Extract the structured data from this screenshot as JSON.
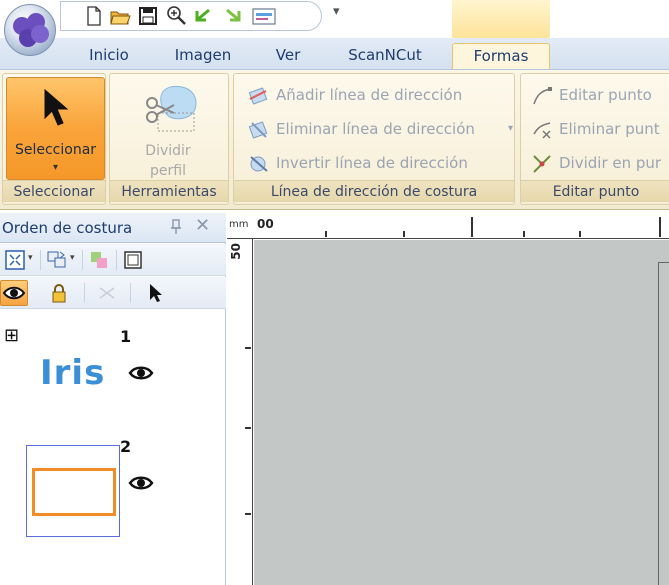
{
  "quick_access": {
    "items": [
      "new-file-icon",
      "open-folder-icon",
      "save-icon",
      "zoom-icon",
      "undo-icon",
      "redo-icon",
      "preview-icon"
    ],
    "more_glyph": "▾"
  },
  "ribbon": {
    "tabs": [
      {
        "label": "Inicio"
      },
      {
        "label": "Imagen"
      },
      {
        "label": "Ver"
      },
      {
        "label": "ScanNCut"
      },
      {
        "label": "Formas"
      }
    ],
    "active_tab": "Formas",
    "groups": {
      "seleccionar": {
        "button_label": "Seleccionar",
        "caret": "▾",
        "group_label": "Seleccionar"
      },
      "herramientas": {
        "button_label_line1": "Dividir",
        "button_label_line2": "perfil",
        "group_label": "Herramientas"
      },
      "linea_direccion": {
        "items": [
          {
            "label": "Añadir línea de dirección"
          },
          {
            "label": "Eliminar línea de dirección"
          },
          {
            "label": "Invertir línea de dirección"
          }
        ],
        "dropdown_caret": "▾",
        "group_label": "Línea de dirección de costura"
      },
      "editar_punto": {
        "items": [
          {
            "label": "Editar punto"
          },
          {
            "label": "Eliminar punt"
          },
          {
            "label": "Dividir en pur"
          }
        ],
        "group_label": "Editar punto"
      }
    },
    "colors": {
      "active_tab_border": "#e7c66b",
      "select_button": "#f9a43a",
      "context_header": "#fde39a"
    }
  },
  "sewing_order_pane": {
    "title": "Orden de costura",
    "pin_glyph": "ᵱ",
    "close_glyph": "✕",
    "items": [
      {
        "number": "1",
        "expand_glyph": "⊞",
        "preview_text": "Iris",
        "preview_color": "#3a8fd6"
      },
      {
        "number": "2",
        "preview_color": "#f28c28",
        "selected": true
      }
    ]
  },
  "canvas": {
    "ruler_unit": "mm",
    "ruler_h_origin": "00",
    "ruler_v_origin": "50",
    "background": "#c3c8c7"
  }
}
